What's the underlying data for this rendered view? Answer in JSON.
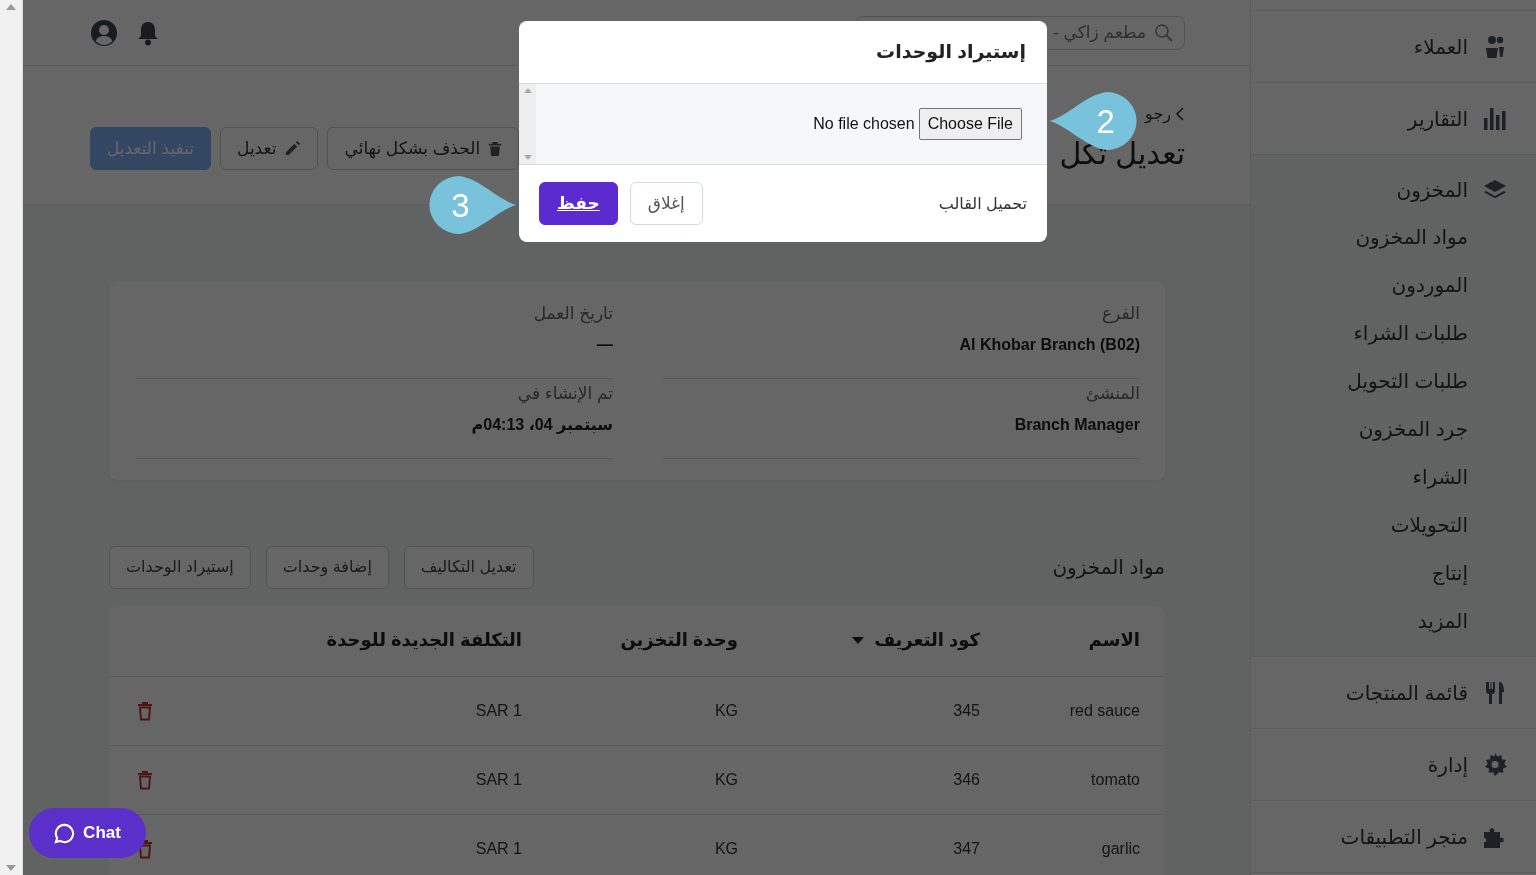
{
  "header": {
    "search_value": "مطعم زاكي -"
  },
  "page": {
    "breadcrumb": "رجو",
    "title": "تعديل تكل",
    "actions": [
      {
        "label": "الحذف بشكل نهائي",
        "kind": "delete",
        "disabled": false
      },
      {
        "label": "تعديل",
        "kind": "edit",
        "disabled": false
      },
      {
        "label": "تنفيذ التعديل",
        "kind": "primary",
        "disabled": true
      }
    ]
  },
  "details": [
    {
      "label": "الفرع",
      "value": "Al Khobar Branch (B02)"
    },
    {
      "label": "تاريخ العمل",
      "value": "—"
    },
    {
      "label": "المنشئ",
      "value": "Branch Manager"
    },
    {
      "label": "تم الإنشاء في",
      "value": "سبتمبر 04، 04:13م"
    }
  ],
  "items_section": {
    "title": "مواد المخزون",
    "buttons": [
      "تعديل التكاليف",
      "إضافة وحدات",
      "إستيراد الوحدات"
    ],
    "table": {
      "columns": [
        {
          "label": "الاسم",
          "sorted": false
        },
        {
          "label": "كود التعريف",
          "sorted": true
        },
        {
          "label": "وحدة التخزين",
          "sorted": false
        },
        {
          "label": "التكلفة الجديدة للوحدة",
          "sorted": false
        }
      ],
      "rows": [
        [
          "red sauce",
          "345",
          "KG",
          "SAR 1"
        ],
        [
          "tomato",
          "346",
          "KG",
          "SAR 1"
        ],
        [
          "garlic",
          "347",
          "KG",
          "SAR 1"
        ]
      ]
    }
  },
  "sidebar": {
    "items": [
      {
        "label": "العملاء",
        "kind": "users",
        "expanded": false
      },
      {
        "label": "التقارير",
        "kind": "chart",
        "expanded": false
      },
      {
        "label": "المخزون",
        "kind": "layers",
        "expanded": true,
        "children": [
          {
            "label": "مواد المخزون"
          },
          {
            "label": "الموردون"
          },
          {
            "label": "طلبات الشراء"
          },
          {
            "label": "طلبات التحويل"
          },
          {
            "label": "جرد المخزون"
          },
          {
            "label": "الشراء"
          },
          {
            "label": "التحويلات"
          },
          {
            "label": "إنتاج"
          },
          {
            "label": "المزيد"
          }
        ]
      },
      {
        "label": "قائمة المنتجات",
        "kind": "utensils",
        "expanded": false
      },
      {
        "label": "إدارة",
        "kind": "gear",
        "expanded": false
      },
      {
        "label": "متجر التطبيقات",
        "kind": "puzzle",
        "expanded": false
      }
    ]
  },
  "modal": {
    "title": "إستيراد الوحدات",
    "file_button": "Choose File",
    "file_status": "No file chosen",
    "template_link": "تحميل القالب",
    "buttons": [
      {
        "label": "إغلاق",
        "kind": "secondary"
      },
      {
        "label": "حفظ",
        "kind": "primary"
      }
    ]
  },
  "callouts": [
    {
      "label": "2"
    },
    {
      "label": "3"
    }
  ],
  "chat": {
    "label": "Chat"
  }
}
